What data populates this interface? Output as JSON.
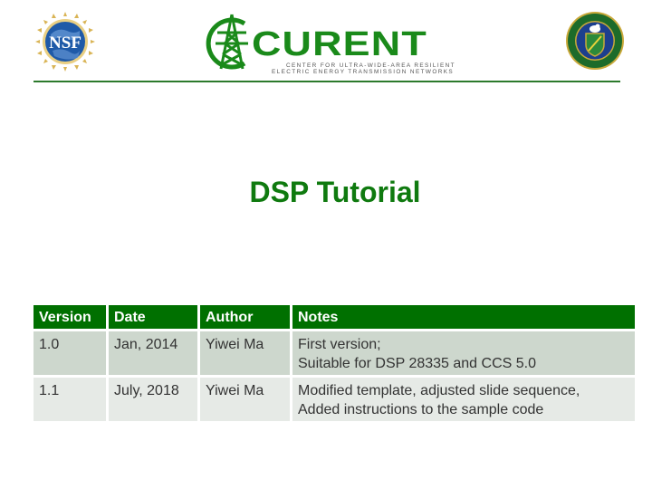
{
  "logos": {
    "nsf": {
      "text": "NSF"
    },
    "curent": {
      "word": "CURENT",
      "subtitle_line1": "CENTER FOR ULTRA-WIDE-AREA RESILIENT",
      "subtitle_line2": "ELECTRIC ENERGY TRANSMISSION NETWORKS"
    },
    "doe": {
      "name": "Department of Energy seal"
    }
  },
  "colors": {
    "brand_green": "#007000",
    "title_green": "#0f7a0f",
    "row_odd": "#cdd7cd",
    "row_even": "#e6eae6"
  },
  "slide": {
    "title": "DSP Tutorial"
  },
  "table": {
    "headers": [
      "Version",
      "Date",
      "Author",
      "Notes"
    ],
    "rows": [
      {
        "version": "1.0",
        "date": "Jan, 2014",
        "author": "Yiwei Ma",
        "notes": [
          "First version;",
          "Suitable for DSP 28335 and CCS 5.0"
        ]
      },
      {
        "version": "1.1",
        "date": "July, 2018",
        "author": "Yiwei Ma",
        "notes": [
          "Modified template, adjusted slide sequence,",
          "Added instructions to the sample code"
        ]
      }
    ]
  }
}
